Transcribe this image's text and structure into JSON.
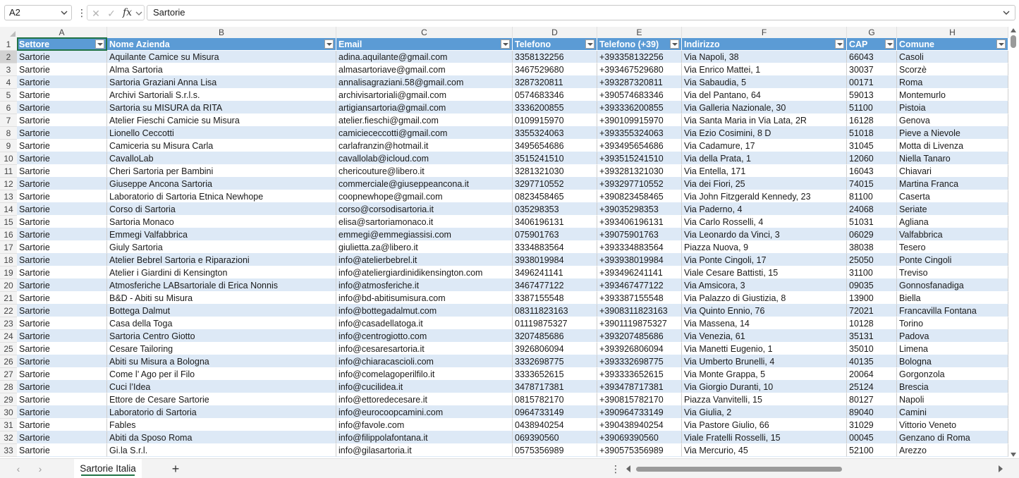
{
  "formula_bar": {
    "name_box": "A2",
    "formula": "Sartorie"
  },
  "columns": [
    "A",
    "B",
    "C",
    "D",
    "E",
    "F",
    "G",
    "H"
  ],
  "header": [
    "Settore",
    "Nome Azienda",
    "Email",
    "Telefono",
    "Telefono (+39)",
    "Indirizzo",
    "CAP",
    "Comune"
  ],
  "rows": [
    {
      "n": "2",
      "c": [
        "Sartorie",
        "Aquilante Camice su Misura",
        "adina.aquilante@gmail.com",
        "3358132256",
        "+393358132256",
        "Via Napoli, 38",
        "66043",
        "Casoli"
      ]
    },
    {
      "n": "3",
      "c": [
        "Sartorie",
        "Alma Sartoria",
        "almasartoriave@gmail.com",
        "3467529680",
        "+393467529680",
        "Via Enrico Mattei, 1",
        "30037",
        "Scorzè"
      ]
    },
    {
      "n": "4",
      "c": [
        "Sartorie",
        "Sartoria Graziani Anna Lisa",
        "annalisagraziani.58@gmail.com",
        "3287320811",
        "+393287320811",
        "Via Sabaudia, 5",
        "00171",
        "Roma"
      ]
    },
    {
      "n": "5",
      "c": [
        "Sartorie",
        "Archivi Sartoriali S.r.l.s.",
        "archivisartoriali@gmail.com",
        "0574683346",
        "+390574683346",
        "Via del Pantano, 64",
        "59013",
        "Montemurlo"
      ]
    },
    {
      "n": "6",
      "c": [
        "Sartorie",
        "Sartoria su MISURA da RITA",
        "artigiansartoria@gmail.com",
        "3336200855",
        "+393336200855",
        "Via Galleria Nazionale, 30",
        "51100",
        "Pistoia"
      ]
    },
    {
      "n": "7",
      "c": [
        "Sartorie",
        "Atelier Fieschi Camicie su Misura",
        "atelier.fieschi@gmail.com",
        "0109915970",
        "+390109915970",
        "Via Santa Maria in Via Lata, 2R",
        "16128",
        "Genova"
      ]
    },
    {
      "n": "8",
      "c": [
        "Sartorie",
        "Lionello Ceccotti",
        "camiciececcotti@gmail.com",
        "3355324063",
        "+393355324063",
        "Via Ezio Cosimini, 8 D",
        "51018",
        "Pieve a Nievole"
      ]
    },
    {
      "n": "9",
      "c": [
        "Sartorie",
        "Camiceria su Misura Carla",
        "carlafranzin@hotmail.it",
        "3495654686",
        "+393495654686",
        "Via Cadamure, 17",
        "31045",
        "Motta di Livenza"
      ]
    },
    {
      "n": "10",
      "c": [
        "Sartorie",
        "CavalloLab",
        "cavallolab@icloud.com",
        "3515241510",
        "+393515241510",
        "Via della Prata, 1",
        "12060",
        "Niella Tanaro"
      ]
    },
    {
      "n": "11",
      "c": [
        "Sartorie",
        "Cheri Sartoria per Bambini",
        "chericouture@libero.it",
        "3281321030",
        "+393281321030",
        "Via Entella, 171",
        "16043",
        "Chiavari"
      ]
    },
    {
      "n": "12",
      "c": [
        "Sartorie",
        "Giuseppe Ancona Sartoria",
        "commerciale@giuseppeancona.it",
        "3297710552",
        "+393297710552",
        "Via dei Fiori, 25",
        "74015",
        "Martina Franca"
      ]
    },
    {
      "n": "13",
      "c": [
        "Sartorie",
        "Laboratorio di Sartoria Etnica Newhope",
        "coopnewhope@gmail.com",
        "0823458465",
        "+390823458465",
        "Via John Fitzgerald Kennedy, 23",
        "81100",
        "Caserta"
      ]
    },
    {
      "n": "14",
      "c": [
        "Sartorie",
        "Corso di Sartoria",
        "corso@corsodisartoria.it",
        "035298353",
        "+39035298353",
        "Via Paderno, 4",
        "24068",
        "Seriate"
      ]
    },
    {
      "n": "15",
      "c": [
        "Sartorie",
        "Sartoria Monaco",
        "elisa@sartoriamonaco.it",
        "3406196131",
        "+393406196131",
        "Via Carlo Rosselli, 4",
        "51031",
        "Agliana"
      ]
    },
    {
      "n": "16",
      "c": [
        "Sartorie",
        "Emmegi Valfabbrica",
        "emmegi@emmegiassisi.com",
        "075901763",
        "+39075901763",
        "Via Leonardo da Vinci, 3",
        "06029",
        "Valfabbrica"
      ]
    },
    {
      "n": "17",
      "c": [
        "Sartorie",
        "Giuly Sartoria",
        "giulietta.za@libero.it",
        "3334883564",
        "+393334883564",
        "Piazza Nuova, 9",
        "38038",
        "Tesero"
      ]
    },
    {
      "n": "18",
      "c": [
        "Sartorie",
        "Atelier Bebrel Sartoria e Riparazioni",
        "info@atelierbebrel.it",
        "3938019984",
        "+393938019984",
        "Via Ponte Cingoli, 17",
        "25050",
        "Ponte Cingoli"
      ]
    },
    {
      "n": "19",
      "c": [
        "Sartorie",
        "Atelier i Giardini di Kensington",
        "info@ateliergiardinidikensington.com",
        "3496241141",
        "+393496241141",
        "Viale Cesare Battisti, 15",
        "31100",
        "Treviso"
      ]
    },
    {
      "n": "20",
      "c": [
        "Sartorie",
        "Atmosferiche LABsartoriale di Erica Nonnis",
        "info@atmosferiche.it",
        "3467477122",
        "+393467477122",
        "Via Amsicora, 3",
        "09035",
        "Gonnosfanadiga"
      ]
    },
    {
      "n": "21",
      "c": [
        "Sartorie",
        "B&D - Abiti su Misura",
        "info@bd-abitisumisura.com",
        "3387155548",
        "+393387155548",
        "Via Palazzo di Giustizia, 8",
        "13900",
        "Biella"
      ]
    },
    {
      "n": "22",
      "c": [
        "Sartorie",
        "Bottega Dalmut",
        "info@bottegadalmut.com",
        "08311823163",
        "+3908311823163",
        "Via Quinto Ennio, 76",
        "72021",
        "Francavilla Fontana"
      ]
    },
    {
      "n": "23",
      "c": [
        "Sartorie",
        "Casa della Toga",
        "info@casadellatoga.it",
        "01119875327",
        "+3901119875327",
        "Via Massena, 14",
        "10128",
        "Torino"
      ]
    },
    {
      "n": "24",
      "c": [
        "Sartorie",
        "Sartoria Centro Giotto",
        "info@centrogiotto.com",
        "3207485686",
        "+393207485686",
        "Via Venezia, 61",
        "35131",
        "Padova"
      ]
    },
    {
      "n": "25",
      "c": [
        "Sartorie",
        "Cesare Tailoring",
        "info@cesaresartoria.it",
        "3926806094",
        "+393926806094",
        "Via Manetti Eugenio, 1",
        "35010",
        "Limena"
      ]
    },
    {
      "n": "26",
      "c": [
        "Sartorie",
        "Abiti su Misura a Bologna",
        "info@chiaracascioli.com",
        "3332698775",
        "+393332698775",
        "Via Umberto Brunelli, 4",
        "40135",
        "Bologna"
      ]
    },
    {
      "n": "27",
      "c": [
        "Sartorie",
        "Come l’ Ago per il Filo",
        "info@comelagoperilfilo.it",
        "3333652615",
        "+393333652615",
        "Via Monte Grappa, 5",
        "20064",
        "Gorgonzola"
      ]
    },
    {
      "n": "28",
      "c": [
        "Sartorie",
        "Cuci l’Idea",
        "info@cucilidea.it",
        "3478717381",
        "+393478717381",
        "Via Giorgio Duranti, 10",
        "25124",
        "Brescia"
      ]
    },
    {
      "n": "29",
      "c": [
        "Sartorie",
        "Ettore de Cesare Sartorie",
        "info@ettoredecesare.it",
        "0815782170",
        "+390815782170",
        "Piazza Vanvitelli, 15",
        "80127",
        "Napoli"
      ]
    },
    {
      "n": "30",
      "c": [
        "Sartorie",
        "Laboratorio di Sartoria",
        "info@eurocoopcamini.com",
        "0964733149",
        "+390964733149",
        "Via Giulia, 2",
        "89040",
        "Camini"
      ]
    },
    {
      "n": "31",
      "c": [
        "Sartorie",
        "Fables",
        "info@favole.com",
        "0438940254",
        "+390438940254",
        "Via Pastore Giulio, 66",
        "31029",
        "Vittorio Veneto"
      ]
    },
    {
      "n": "32",
      "c": [
        "Sartorie",
        "Abiti da Sposo Roma",
        "info@filippolafontana.it",
        "069390560",
        "+39069390560",
        "Viale Fratelli Rosselli, 15",
        "00045",
        "Genzano di Roma"
      ]
    },
    {
      "n": "33",
      "c": [
        "Sartorie",
        "Gi.la S.r.l.",
        "info@gilasartoria.it",
        "0575356989",
        "+390575356989",
        "Via Mercurio, 45",
        "52100",
        "Arezzo"
      ]
    }
  ],
  "sheet_tabs": [
    {
      "label": "Sartorie Italia",
      "active": true
    }
  ],
  "colors": {
    "header_blue": "#5b9bd5",
    "band_blue": "#dde9f6",
    "excel_green": "#217346"
  }
}
